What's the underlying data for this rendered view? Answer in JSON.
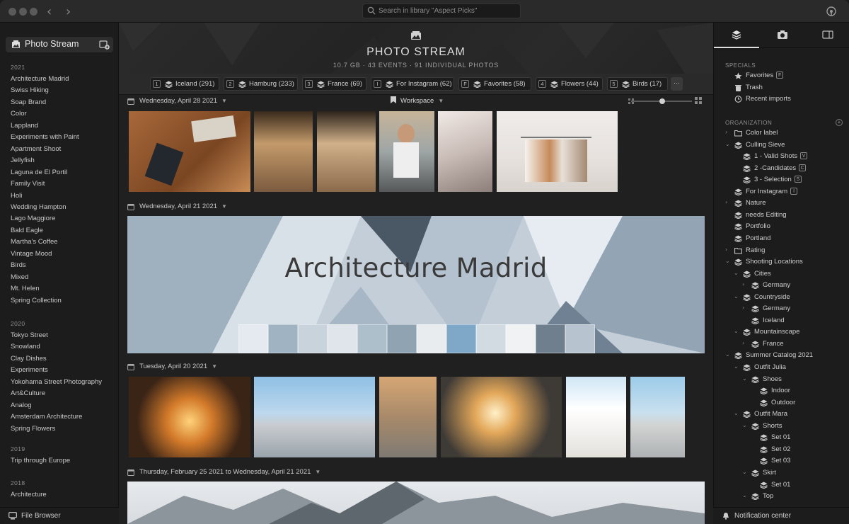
{
  "titlebar": {
    "search_placeholder": "Search in library \"Aspect Picks\""
  },
  "sidebar": {
    "photo_stream_label": "Photo Stream",
    "groups": [
      {
        "year": "2021",
        "albums": [
          "Architecture Madrid",
          "Swiss Hiking",
          "Soap Brand",
          "Color",
          "Lappland",
          "Experiments with Paint",
          "Apartment Shoot",
          "Jellyfish",
          "Laguna de El Portil",
          "Family Visit",
          "Holi",
          "Wedding Hampton",
          "Lago Maggiore",
          "Bald Eagle",
          "Martha's Coffee",
          "Vintage Mood",
          "Birds",
          "Mixed",
          "Mt. Helen",
          "Spring Collection"
        ]
      },
      {
        "year": "2020",
        "albums": [
          "Tokyo Street",
          "Snowland",
          "Clay Dishes",
          "Experiments",
          "Yokohama Street Photography",
          "Art&Culture",
          "Analog",
          "Amsterdam Architecture",
          "Spring Flowers"
        ]
      },
      {
        "year": "2019",
        "albums": [
          "Trip through Europe"
        ]
      },
      {
        "year": "2018",
        "albums": [
          "Architecture"
        ]
      }
    ],
    "file_browser_label": "File Browser"
  },
  "main": {
    "title": "PHOTO STREAM",
    "subtitle": "10.7 GB  ·  43 EVENTS  ·  91 INDIVIDUAL PHOTOS",
    "quick_albums": [
      {
        "key": "1",
        "label": "Iceland (291)"
      },
      {
        "key": "2",
        "label": "Hamburg (233)"
      },
      {
        "key": "3",
        "label": "France (69)"
      },
      {
        "key": "I",
        "label": "For Instagram (62)"
      },
      {
        "key": "F",
        "label": "Favorites (58)"
      },
      {
        "key": "4",
        "label": "Flowers (44)"
      },
      {
        "key": "5",
        "label": "Birds (17)"
      }
    ],
    "more_label": "···",
    "workspace_label": "Workspace",
    "events": [
      {
        "date": "Wednesday, April 28 2021"
      },
      {
        "date": "Wednesday, April 21 2021",
        "banner_title": "Architecture Madrid"
      },
      {
        "date": "Tuesday, April 20 2021"
      },
      {
        "date": "Thursday, February 25 2021 to Wednesday, April 21 2021"
      }
    ]
  },
  "right_sidebar": {
    "specials_title": "SPECIALS",
    "specials": [
      {
        "label": "Favorites",
        "badge": "F"
      },
      {
        "label": "Trash",
        "badge": ""
      },
      {
        "label": "Recent imports",
        "badge": ""
      }
    ],
    "organization_title": "ORGANIZATION",
    "tree": [
      {
        "label": "Color label",
        "badge": ""
      },
      {
        "label": "Culling Sieve",
        "badge": ""
      },
      {
        "label": "1 - Valid Shots",
        "badge": "V"
      },
      {
        "label": "2 -Candidates",
        "badge": "C"
      },
      {
        "label": "3 - Selection",
        "badge": "S"
      },
      {
        "label": "For Instagram",
        "badge": "I"
      },
      {
        "label": "Nature",
        "badge": ""
      },
      {
        "label": "needs Editing",
        "badge": ""
      },
      {
        "label": "Portfolio",
        "badge": ""
      },
      {
        "label": "Portland",
        "badge": ""
      },
      {
        "label": "Rating",
        "badge": ""
      },
      {
        "label": "Shooting Locations",
        "badge": ""
      },
      {
        "label": "Cities",
        "badge": ""
      },
      {
        "label": "Germany",
        "badge": ""
      },
      {
        "label": "Countryside",
        "badge": ""
      },
      {
        "label": "Germany",
        "badge": ""
      },
      {
        "label": "Iceland",
        "badge": ""
      },
      {
        "label": "Mountainscape",
        "badge": ""
      },
      {
        "label": "France",
        "badge": ""
      },
      {
        "label": "Summer Catalog 2021",
        "badge": ""
      },
      {
        "label": "Outfit Julia",
        "badge": ""
      },
      {
        "label": "Shoes",
        "badge": ""
      },
      {
        "label": "Indoor",
        "badge": ""
      },
      {
        "label": "Outdoor",
        "badge": ""
      },
      {
        "label": "Outfit Mara",
        "badge": ""
      },
      {
        "label": "Shorts",
        "badge": ""
      },
      {
        "label": "Set 01",
        "badge": ""
      },
      {
        "label": "Set 02",
        "badge": ""
      },
      {
        "label": "Set 03",
        "badge": ""
      },
      {
        "label": "Skirt",
        "badge": ""
      },
      {
        "label": "Set 01",
        "badge": ""
      },
      {
        "label": "Top",
        "badge": ""
      }
    ],
    "notification_label": "Notification center"
  }
}
